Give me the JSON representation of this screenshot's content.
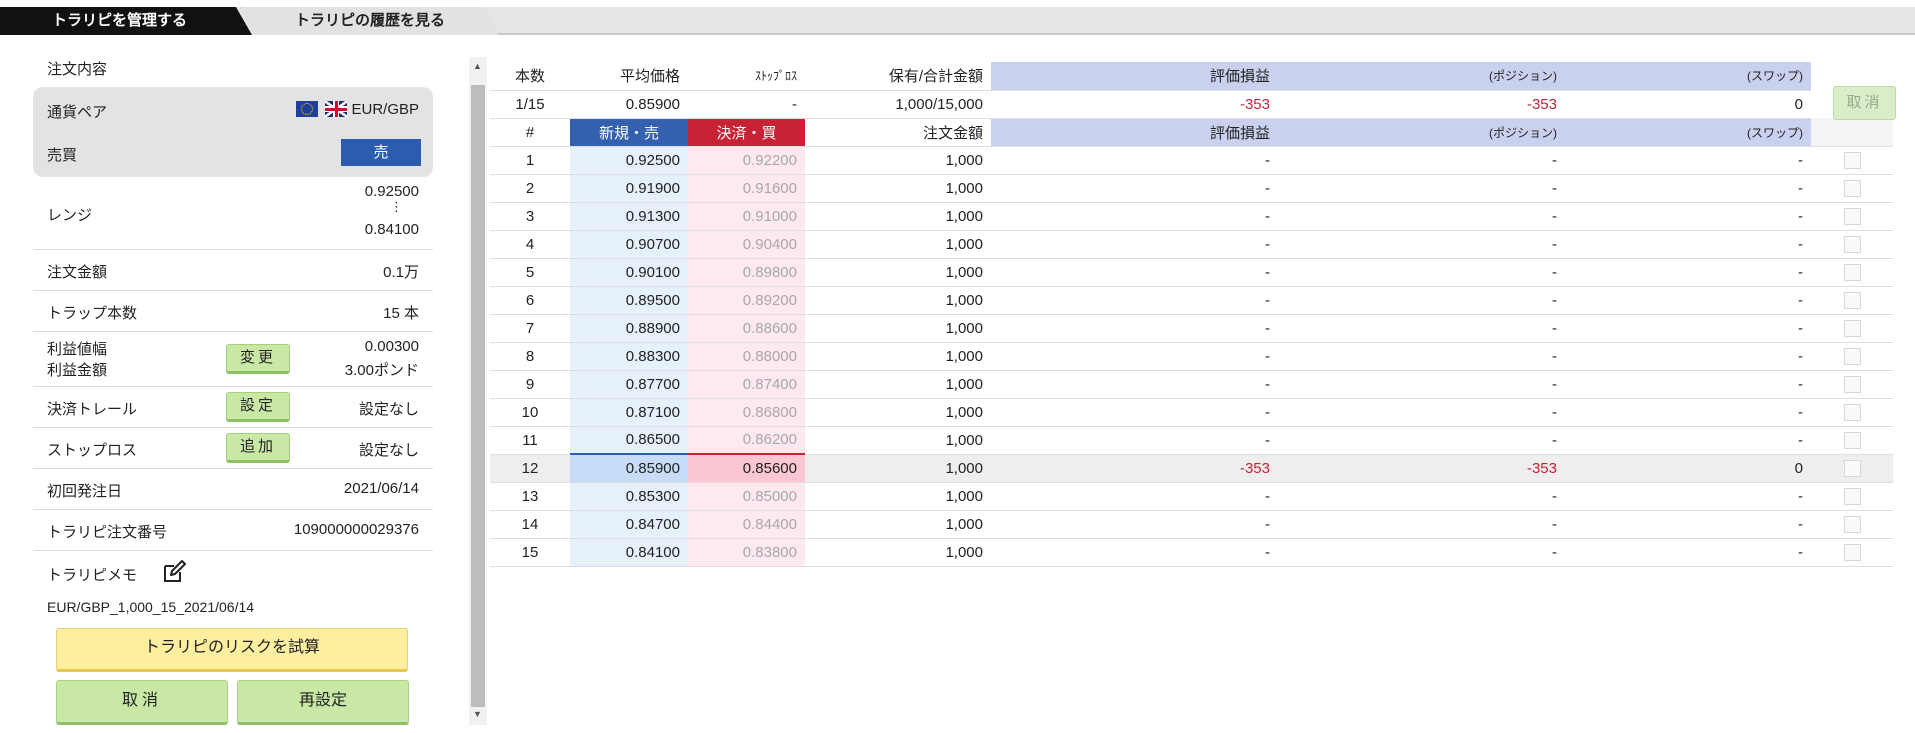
{
  "tabs": [
    {
      "label": "トラリピを管理する",
      "active": true
    },
    {
      "label": "トラリピの履歴を見る",
      "active": false
    }
  ],
  "order": {
    "section_title": "注文内容",
    "pair_label": "通貨ペア",
    "pair_value": "EUR/GBP",
    "side_label": "売買",
    "side_value": "売",
    "range_label": "レンジ",
    "range_high": "0.92500",
    "range_sep": "⋮",
    "range_low": "0.84100",
    "amount_label": "注文金額",
    "amount_value": "0.1万",
    "traps_label": "トラップ本数",
    "traps_value": "15 本",
    "profit_width_label": "利益値幅",
    "profit_amount_label": "利益金額",
    "profit_width_value": "0.00300",
    "profit_amount_value": "3.00ポンド",
    "change_button": "変更",
    "trail_label": "決済トレール",
    "trail_button": "設定",
    "trail_value": "設定なし",
    "stop_label": "ストップロス",
    "stop_button": "追加",
    "stop_value": "設定なし",
    "first_date_label": "初回発注日",
    "first_date_value": "2021/06/14",
    "order_no_label": "トラリピ注文番号",
    "order_no_value": "109000000029376",
    "memo_label": "トラリピメモ",
    "memo_value": "EUR/GBP_1,000_15_2021/06/14",
    "risk_button": "トラリピのリスクを試算",
    "cancel_button": "取消",
    "reset_button": "再設定"
  },
  "summary": {
    "headers": [
      "本数",
      "平均価格",
      "ｽﾄｯﾌﾟﾛｽ",
      "保有/合計金額",
      "評価損益",
      "(ポジション)",
      "(スワップ)"
    ],
    "values": [
      "1/15",
      "0.85900",
      "-",
      "1,000/15,000",
      "-353",
      "-353",
      "0"
    ],
    "cancel_label": "取消"
  },
  "grid": {
    "headers": [
      "#",
      "新規・売",
      "決済・買",
      "注文金額",
      "評価損益",
      "(ポジション)",
      "(スワップ)"
    ],
    "rows": [
      {
        "n": "1",
        "sell": "0.92500",
        "buy": "0.92200",
        "amt": "1,000",
        "pl": "-",
        "pos": "-",
        "swap": "-"
      },
      {
        "n": "2",
        "sell": "0.91900",
        "buy": "0.91600",
        "amt": "1,000",
        "pl": "-",
        "pos": "-",
        "swap": "-"
      },
      {
        "n": "3",
        "sell": "0.91300",
        "buy": "0.91000",
        "amt": "1,000",
        "pl": "-",
        "pos": "-",
        "swap": "-"
      },
      {
        "n": "4",
        "sell": "0.90700",
        "buy": "0.90400",
        "amt": "1,000",
        "pl": "-",
        "pos": "-",
        "swap": "-"
      },
      {
        "n": "5",
        "sell": "0.90100",
        "buy": "0.89800",
        "amt": "1,000",
        "pl": "-",
        "pos": "-",
        "swap": "-"
      },
      {
        "n": "6",
        "sell": "0.89500",
        "buy": "0.89200",
        "amt": "1,000",
        "pl": "-",
        "pos": "-",
        "swap": "-"
      },
      {
        "n": "7",
        "sell": "0.88900",
        "buy": "0.88600",
        "amt": "1,000",
        "pl": "-",
        "pos": "-",
        "swap": "-"
      },
      {
        "n": "8",
        "sell": "0.88300",
        "buy": "0.88000",
        "amt": "1,000",
        "pl": "-",
        "pos": "-",
        "swap": "-"
      },
      {
        "n": "9",
        "sell": "0.87700",
        "buy": "0.87400",
        "amt": "1,000",
        "pl": "-",
        "pos": "-",
        "swap": "-"
      },
      {
        "n": "10",
        "sell": "0.87100",
        "buy": "0.86800",
        "amt": "1,000",
        "pl": "-",
        "pos": "-",
        "swap": "-"
      },
      {
        "n": "11",
        "sell": "0.86500",
        "buy": "0.86200",
        "amt": "1,000",
        "pl": "-",
        "pos": "-",
        "swap": "-"
      },
      {
        "n": "12",
        "sell": "0.85900",
        "buy": "0.85600",
        "amt": "1,000",
        "pl": "-353",
        "pos": "-353",
        "swap": "0",
        "active": true
      },
      {
        "n": "13",
        "sell": "0.85300",
        "buy": "0.85000",
        "amt": "1,000",
        "pl": "-",
        "pos": "-",
        "swap": "-"
      },
      {
        "n": "14",
        "sell": "0.84700",
        "buy": "0.84400",
        "amt": "1,000",
        "pl": "-",
        "pos": "-",
        "swap": "-"
      },
      {
        "n": "15",
        "sell": "0.84100",
        "buy": "0.83800",
        "amt": "1,000",
        "pl": "-",
        "pos": "-",
        "swap": "-"
      }
    ]
  },
  "icons": {
    "pair_flags": [
      "eu-flag-icon",
      "uk-flag-icon"
    ],
    "memo_edit": "edit-icon"
  },
  "colors": {
    "sell": "#3361b0",
    "buy": "#c82335",
    "negative": "#c3243a",
    "button_green": "#c9e8a6",
    "button_yellow": "#fdeea0"
  }
}
